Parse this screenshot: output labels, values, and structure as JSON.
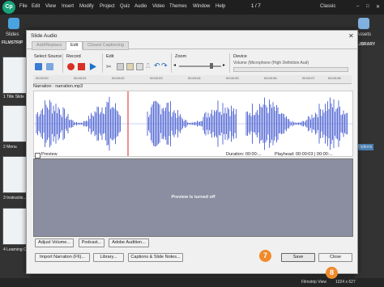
{
  "app": {
    "logo": "Cp",
    "menu": [
      "File",
      "Edit",
      "View",
      "Insert",
      "Modify",
      "Project",
      "Quiz",
      "Audio",
      "Video",
      "Themes",
      "Window",
      "Help"
    ],
    "page_counter": "1  /  7",
    "workspace": "Classic"
  },
  "toolbar": {
    "slides_label": "Slides",
    "assets_label": "Assets"
  },
  "filmstrip": {
    "header": "FILMSTRIP",
    "items": [
      "1 Title Slide",
      "2 Menu",
      "3 Instructio...",
      "4 Learning O..."
    ]
  },
  "right_panel": {
    "library_label": "LIBRARY",
    "options_label": "Options"
  },
  "dialog": {
    "title": "Slide Audio",
    "tabs": [
      "Add/Replace",
      "Edit",
      "Closed Captioning"
    ],
    "groups": {
      "select_source": "Select Source",
      "record": "Record",
      "edit": "Edit",
      "zoom": "Zoom",
      "device": "Device",
      "device_value": "Volume (Microphone (High Definition Aud)"
    },
    "ruler_ticks": [
      "00:00:00",
      "00:00:01",
      "00:00:02",
      "00:00:03",
      "00:00:04",
      "00:00:05",
      "00:00:06",
      "00:00:07",
      "00:00:08"
    ],
    "narration_label": "Narration : narration.mp3",
    "preview_label": "Preview",
    "duration_label": "Duration:",
    "duration_value": "00:00:...",
    "playhead_label": "Playhead:",
    "playhead_value": "00:00:03",
    "time_total": "00:00:...",
    "preview_message": "Preview is turned off",
    "buttons": {
      "adjust_volume": "Adjust Volume...",
      "podcast": "Podcast...",
      "adobe_audition": "Adobe Audition...",
      "import_narration": "Import Narration (F6)...",
      "library": "Library...",
      "captions_notes": "Captions & Slide Notes...",
      "save": "Save",
      "close": "Close"
    }
  },
  "callouts": {
    "save_step": "7",
    "close_step": "8"
  },
  "status": {
    "view": "Filmstrip View",
    "resolution": "1024 x 627"
  },
  "colors": {
    "waveform": "#5b6fd6",
    "playhead": "#e02020",
    "callout": "#f08a2c",
    "preview_bg": "#8a8ea0"
  }
}
